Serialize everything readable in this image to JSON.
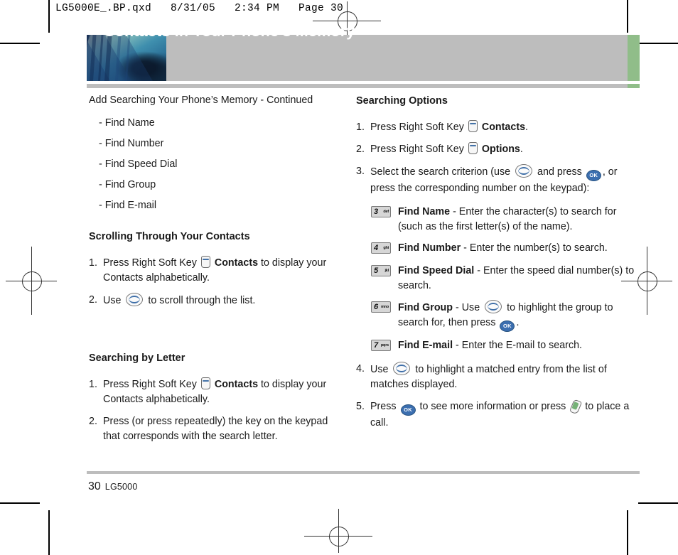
{
  "print_marks": {
    "file_stamp": "LG5000E_.BP.qxd   8/31/05   2:34 PM   Page 30"
  },
  "banner": {
    "title": "Contacts in Your Phone’s Memory",
    "bar_color": "#bdbdbd",
    "accent_color": "#90bd89"
  },
  "left_column": {
    "intro": "Add Searching Your Phone’s Memory - Continued",
    "bullets": [
      "- Find Name",
      "- Find Number",
      "- Find Speed Dial",
      "- Find Group",
      "- Find E-mail"
    ],
    "section1": {
      "heading": "Scrolling Through Your Contacts",
      "steps": [
        {
          "num": "1.",
          "pre": "Press Right Soft Key",
          "icon": "soft-key-icon",
          "bold": "Contacts",
          "post": " to display your Contacts alphabetically."
        },
        {
          "num": "2.",
          "pre": "Use",
          "icon": "navigation-key-icon",
          "post": "to scroll through the list."
        }
      ]
    },
    "section2": {
      "heading": "Searching by Letter",
      "steps": [
        {
          "num": "1.",
          "pre": "Press Right Soft Key",
          "icon": "soft-key-icon",
          "bold": "Contacts",
          "post": " to display your Contacts alphabetically."
        },
        {
          "num": "2.",
          "pre": "Press (or press repeatedly) the key on the keypad that corresponds with the search letter."
        }
      ]
    }
  },
  "right_column": {
    "heading": "Searching Options",
    "steps": [
      {
        "num": "1.",
        "pre": "Press Right Soft Key",
        "icon": "soft-key-icon",
        "bold": "Contacts",
        "post": "."
      },
      {
        "num": "2.",
        "pre": "Press Right Soft Key",
        "icon": "soft-key-icon",
        "bold": "Options",
        "post": "."
      },
      {
        "num": "3.",
        "pre": "Select the search criterion (use",
        "icon": "navigation-key-icon",
        "mid": "and press",
        "icon2": "ok-key-icon",
        "post": ", or press the corresponding number on the keypad):"
      }
    ],
    "key_items": [
      {
        "key_digit": "3",
        "key_letters": "def",
        "bold": "Find Name",
        "text": " - Enter the character(s) to search for (such as the first letter(s) of the name)."
      },
      {
        "key_digit": "4",
        "key_letters": "ghi",
        "bold": "Find Number",
        "text": " - Enter the number(s) to search."
      },
      {
        "key_digit": "5",
        "key_letters": "jkl",
        "bold": "Find Speed Dial",
        "text": " - Enter the speed dial number(s) to search."
      },
      {
        "key_digit": "6",
        "key_letters": "mno",
        "bold": "Find Group",
        "text_pre": " - Use",
        "icon": "navigation-key-icon",
        "text_mid": "to highlight the group to search for, then press",
        "icon2": "ok-key-icon",
        "text_post": "."
      },
      {
        "key_digit": "7",
        "key_letters": "pqrs",
        "bold": "Find E-mail",
        "text": " - Enter the E-mail to search."
      }
    ],
    "steps_tail": [
      {
        "num": "4.",
        "pre": "Use",
        "icon": "navigation-key-icon",
        "post": "to highlight a matched entry from the list of matches displayed."
      },
      {
        "num": "5.",
        "pre": "Press",
        "icon": "ok-key-icon",
        "mid": "to see more information or press",
        "icon2": "send-key-icon",
        "post": "to place a call."
      }
    ]
  },
  "footer": {
    "page_number": "30",
    "model": "LG5000"
  }
}
